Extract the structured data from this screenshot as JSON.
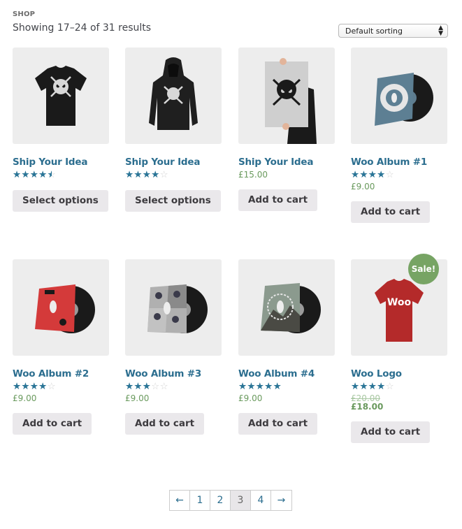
{
  "breadcrumb": "SHOP",
  "result_count": "Showing 17–24 of 31 results",
  "sorting": {
    "selected": "Default sorting",
    "icon": "up-down-arrows-icon"
  },
  "colors": {
    "link": "#2c6e8f",
    "star_filled": "#2a7597",
    "star_empty": "#d6d6d6",
    "price": "#6a9a5e",
    "sale_badge": "#77a464",
    "button_bg": "#eae8eb",
    "thumb_bg": "#ededed"
  },
  "products": [
    {
      "title": "Ship Your Idea",
      "image": "black-skull-tshirt",
      "rating": 4.5,
      "price": null,
      "button": "Select options"
    },
    {
      "title": "Ship Your Idea",
      "image": "black-skull-hoodie",
      "rating": 4,
      "price": null,
      "button": "Select options"
    },
    {
      "title": "Ship Your Idea",
      "image": "skull-poster",
      "rating": null,
      "price": "£15.00",
      "button": "Add to cart"
    },
    {
      "title": "Woo Album #1",
      "image": "blue-vinyl-album",
      "rating": 4,
      "price": "£9.00",
      "button": "Add to cart"
    },
    {
      "title": "Woo Album #2",
      "image": "red-vinyl-album",
      "rating": 4,
      "price": "£9.00",
      "button": "Add to cart"
    },
    {
      "title": "Woo Album #3",
      "image": "ninja-vinyl-album",
      "rating": 3,
      "price": "£9.00",
      "button": "Add to cart"
    },
    {
      "title": "Woo Album #4",
      "image": "landscape-vinyl-album",
      "rating": 5,
      "price": "£9.00",
      "button": "Add to cart"
    },
    {
      "title": "Woo Logo",
      "image": "red-woo-tshirt",
      "rating": 4,
      "price_old": "£20.00",
      "price": "£18.00",
      "button": "Add to cart",
      "badge": "Sale!"
    }
  ],
  "pagination": {
    "prev": "←",
    "pages": [
      "1",
      "2",
      "3",
      "4"
    ],
    "current": "3",
    "next": "→"
  },
  "image_text": {
    "woo_logo_shirt": "Woo"
  }
}
